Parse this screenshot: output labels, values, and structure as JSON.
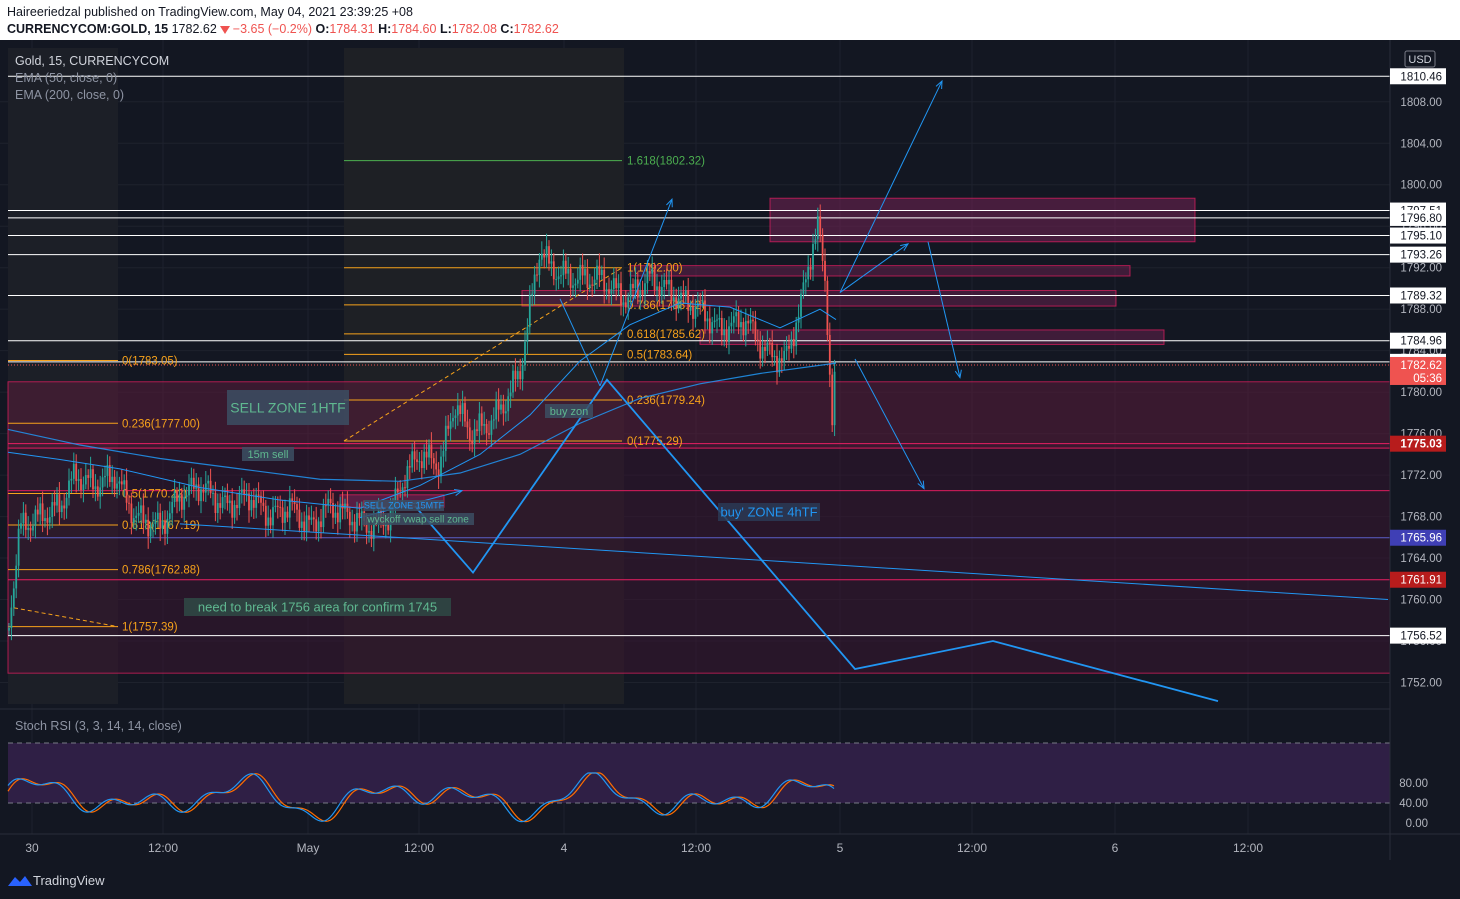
{
  "header": {
    "author": "Haireeriedzal",
    "publish_text": "published on TradingView.com, May 04, 2021 23:39:25 +08",
    "symbol": "CURRENCYCOM:GOLD, 15",
    "last": "1782.62",
    "change": "−3.65 (−0.2%)",
    "o_label": "O:",
    "o_value": "1784.31",
    "h_label": "H:",
    "h_value": "1784.60",
    "l_label": "L:",
    "l_value": "1782.08",
    "c_label": "C:",
    "c_value": "1782.62"
  },
  "legend": {
    "title": "Gold, 15, CURRENCYCOM",
    "ema50": "EMA (50, close, 0)",
    "ema200": "EMA (200, close, 0)",
    "stoch": "Stoch RSI (3, 3, 14, 14, close)"
  },
  "currency": "USD",
  "footer": {
    "brand": "TradingView"
  },
  "colors": {
    "background": "#131722",
    "up": "#26a69a",
    "down": "#ef5350",
    "fib": "#f7a21b",
    "zone": "#e91e63",
    "ema": "#2196f3",
    "stoch_k": "#2196f3",
    "stoch_d": "#ff6d00"
  },
  "chart_data": {
    "type": "candlestick",
    "y_range": [
      1749,
      1813
    ],
    "x_ticks": [
      "30",
      "12:00",
      "May",
      "12:00",
      "4",
      "12:00",
      "5",
      "12:00",
      "6",
      "12:00"
    ],
    "price_ticks": [
      "1808.00",
      "1804.00",
      "1800.00",
      "1796.00",
      "1792.00",
      "1788.00",
      "1784.00",
      "1780.00",
      "1776.00",
      "1772.00",
      "1768.00",
      "1764.00",
      "1760.00",
      "1756.00",
      "1752.00"
    ],
    "price_tick_values": [
      1808,
      1804,
      1800,
      1796,
      1792,
      1788,
      1784,
      1780,
      1776,
      1772,
      1768,
      1764,
      1760,
      1756,
      1752
    ],
    "horizontal_levels": [
      "1810.46",
      "1797.51",
      "1796.80",
      "1795.10",
      "1793.26",
      "1789.32",
      "1784.96",
      "1782.92",
      "1765.96",
      "1761.91",
      "1756.52"
    ],
    "horizontal_level_values": [
      1810.46,
      1797.51,
      1796.8,
      1795.1,
      1793.26,
      1789.32,
      1784.96,
      1782.92,
      1765.96,
      1761.91,
      1756.52
    ],
    "current_price": {
      "label": "1782.62",
      "value": 1782.62,
      "countdown": "05:36"
    },
    "marked_price": {
      "label": "1775.03",
      "value": 1775.03
    },
    "violet_price": {
      "label": "1765.96",
      "value": 1765.96
    },
    "fib_left": {
      "labels": [
        "0(1783.05)",
        "0.236(1777.00)",
        "0.5(1770.22)",
        "0.618(1767.19)",
        "0.786(1762.88)",
        "1(1757.39)"
      ],
      "values": [
        1783.05,
        1777.0,
        1770.22,
        1767.19,
        1762.88,
        1757.39
      ]
    },
    "fib_right": {
      "labels": [
        "1.618(1802.32)",
        "1(1792.00)",
        "0.786(1788.42)",
        "0.618(1785.62)",
        "0.5(1783.64)",
        "0.236(1779.24)",
        "0(1775.29)"
      ],
      "values": [
        1802.32,
        1792.0,
        1788.42,
        1785.62,
        1783.64,
        1779.24,
        1775.29
      ]
    },
    "annotations": [
      "SELL ZONE 1HTF",
      "15m sell",
      "buy zon",
      "buy' ZONE 4hTF",
      "need to break 1756 area for confirm 1745",
      "SELL ZONE 15MTF",
      "wyckoff vwap sell zone"
    ],
    "stoch_levels": [
      "80.00",
      "40.00",
      "0.00"
    ],
    "stoch_level_values": [
      80,
      40,
      0
    ]
  }
}
